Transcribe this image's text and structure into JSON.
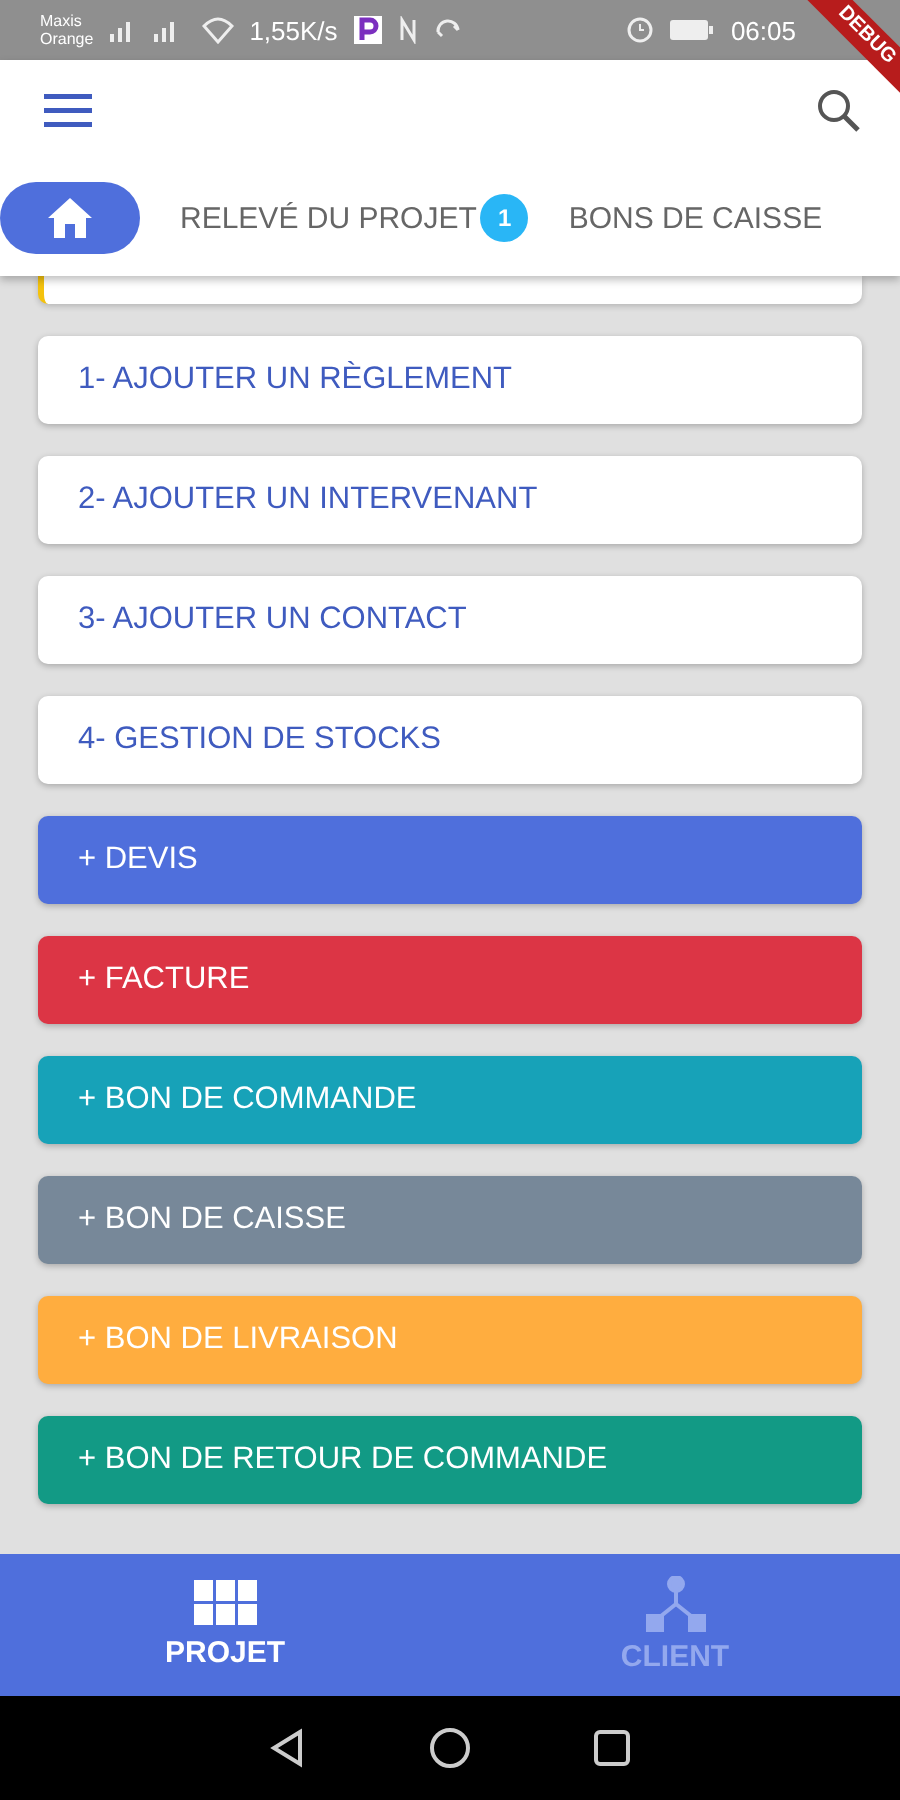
{
  "status_bar": {
    "carrier_line_1": "Maxis",
    "carrier_line_2": "Orange",
    "speed": "1,55K/s",
    "time": "06:05"
  },
  "debug_banner": {
    "label": "DEBUG"
  },
  "tabs": [
    {
      "kind": "icon",
      "selected": true
    },
    {
      "kind": "text",
      "label": "RELEVÉ DU PROJET",
      "badge": "1",
      "selected": false
    },
    {
      "kind": "text",
      "label": "BONS DE CAISSE",
      "selected": false
    }
  ],
  "partial_card": {
    "color": "#f4c20d"
  },
  "actions": [
    {
      "kind": "outline",
      "label": "1- AJOUTER UN RÈGLEMENT"
    },
    {
      "kind": "outline",
      "label": "2- AJOUTER UN INTERVENANT"
    },
    {
      "kind": "outline",
      "label": "3- AJOUTER UN CONTACT"
    },
    {
      "kind": "outline",
      "label": "4- GESTION DE STOCKS"
    },
    {
      "kind": "filled",
      "label": "+ DEVIS",
      "color": "#4f6fdc"
    },
    {
      "kind": "filled",
      "label": "+ FACTURE",
      "color": "#dc3545"
    },
    {
      "kind": "filled",
      "label": "+ BON DE COMMANDE",
      "color": "#17a2b8"
    },
    {
      "kind": "filled",
      "label": "+ BON DE CAISSE",
      "color": "#778899"
    },
    {
      "kind": "filled",
      "label": "+ BON DE LIVRAISON",
      "color": "#ffad3f"
    },
    {
      "kind": "filled",
      "label": "+ BON DE RETOUR DE COMMANDE",
      "color": "#129a85"
    }
  ],
  "bottom_nav": [
    {
      "kind": "grid",
      "label": "PROJET",
      "selected": true
    },
    {
      "kind": "network",
      "label": "CLIENT",
      "selected": false
    }
  ]
}
